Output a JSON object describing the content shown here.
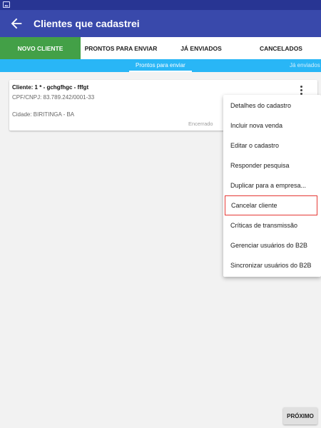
{
  "app_bar": {
    "title": "Clientes que cadastrei"
  },
  "main_tabs": [
    {
      "label": "NOVO CLIENTE"
    },
    {
      "label": "PRONTOS PARA ENVIAR"
    },
    {
      "label": "JÁ ENVIADOS"
    },
    {
      "label": "CANCELADOS"
    }
  ],
  "sub_tabs": {
    "active": "Prontos para enviar",
    "next": "Já enviados"
  },
  "client_card": {
    "title": "Cliente: 1 * - gchgfhgc - fffgt",
    "cpf_cnpj": "CPF/CNPJ: 83.789.242/0001-33",
    "city": "Cidade: BIRITINGA - BA",
    "status": "Encerrado"
  },
  "context_menu": {
    "items": [
      "Detalhes do cadastro",
      "Incluir nova venda",
      "Editar o cadastro",
      "Responder pesquisa",
      "Duplicar para a empresa...",
      "Cancelar cliente",
      "Críticas de transmissão",
      "Gerenciar usuários do B2B",
      "Sincronizar usuários do B2B"
    ],
    "highlighted_item": "Cancelar cliente",
    "highlight_color": "#e53935"
  },
  "footer": {
    "next_label": "PRÓXIMO"
  },
  "colors": {
    "status_bar": "#283593",
    "app_bar": "#3949ab",
    "active_tab": "#43a047",
    "sub_tab_bar": "#29b6f6"
  }
}
